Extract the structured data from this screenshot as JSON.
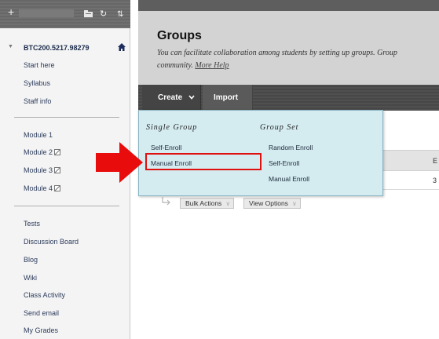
{
  "sidebar": {
    "toolbar": {
      "add_icon": "plus-icon",
      "folder_icon": "folder-icon",
      "refresh_icon": "refresh-icon",
      "sort_icon": "sort-icon"
    },
    "course_id": "BTC200.5217.98279",
    "course_items": [
      "Start here",
      "Syllabus",
      "Staff info"
    ],
    "modules": [
      {
        "label": "Module 1",
        "hidden": false
      },
      {
        "label": "Module 2",
        "hidden": true
      },
      {
        "label": "Module 3",
        "hidden": true
      },
      {
        "label": "Module 4",
        "hidden": true
      }
    ],
    "tools": [
      "Tests",
      "Discussion Board",
      "Blog",
      "Wiki",
      "Class Activity",
      "Send email",
      "My Grades"
    ]
  },
  "main": {
    "title": "Groups",
    "description": "You can facilitate collaboration among students by setting up groups. Group",
    "description_line2": "community.",
    "more_help": "More Help",
    "actions": {
      "create_label": "Create",
      "import_label": "Import"
    },
    "bulk_actions_label": "Bulk Actions",
    "view_options_label": "View Options",
    "table_header_partial": "E",
    "table_cell_partial": "3"
  },
  "dropdown": {
    "single_group_heading": "Single Group",
    "group_set_heading": "Group Set",
    "single_group_items": [
      "Self-Enroll",
      "Manual Enroll"
    ],
    "group_set_items": [
      "Random Enroll",
      "Self-Enroll",
      "Manual Enroll"
    ],
    "highlighted_item": "Manual Enroll"
  },
  "colors": {
    "highlight_border": "#e01010",
    "callout_arrow": "#e80c0c",
    "dropdown_bg": "#d4ebf0"
  }
}
